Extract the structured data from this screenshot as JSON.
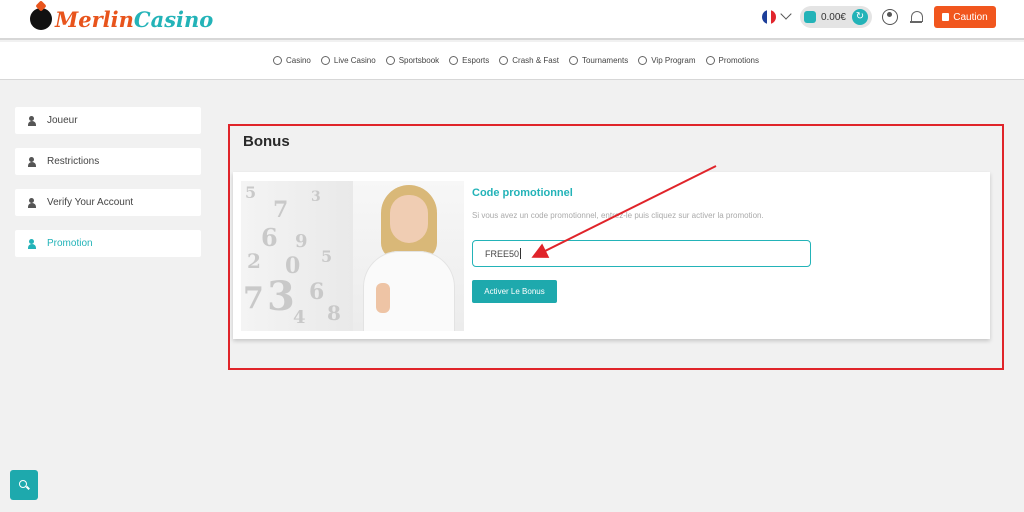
{
  "header": {
    "logo_part1": "Merlin",
    "logo_part2": "Casino",
    "language": "FR",
    "balance": "0.00€",
    "caution_label": "Caution"
  },
  "nav": {
    "items": [
      {
        "label": "Casino",
        "icon": "casino-icon"
      },
      {
        "label": "Live Casino",
        "icon": "live-casino-icon"
      },
      {
        "label": "Sportsbook",
        "icon": "sportsbook-icon"
      },
      {
        "label": "Esports",
        "icon": "esports-icon"
      },
      {
        "label": "Crash & Fast",
        "icon": "crash-icon"
      },
      {
        "label": "Tournaments",
        "icon": "tournaments-icon"
      },
      {
        "label": "Vip Program",
        "icon": "vip-icon"
      },
      {
        "label": "Promotions",
        "icon": "promotions-icon"
      }
    ]
  },
  "sidebar": {
    "items": [
      {
        "label": "Joueur",
        "icon": "user-gear-icon"
      },
      {
        "label": "Restrictions",
        "icon": "user-lock-icon"
      },
      {
        "label": "Verify Your Account",
        "icon": "user-check-icon"
      },
      {
        "label": "Promotion",
        "icon": "user-tag-icon",
        "active": true
      }
    ]
  },
  "main": {
    "title": "Bonus",
    "promo_title": "Code promotionnel",
    "promo_description": "Si vous avez un code promotionnel, entrez-le puis cliquez sur activer la promotion.",
    "promo_code_value": "FREE50",
    "activate_label": "Activer Le Bonus"
  },
  "colors": {
    "accent": "#23b3b8",
    "caution": "#f1561e",
    "highlight_frame": "#e0242a"
  }
}
